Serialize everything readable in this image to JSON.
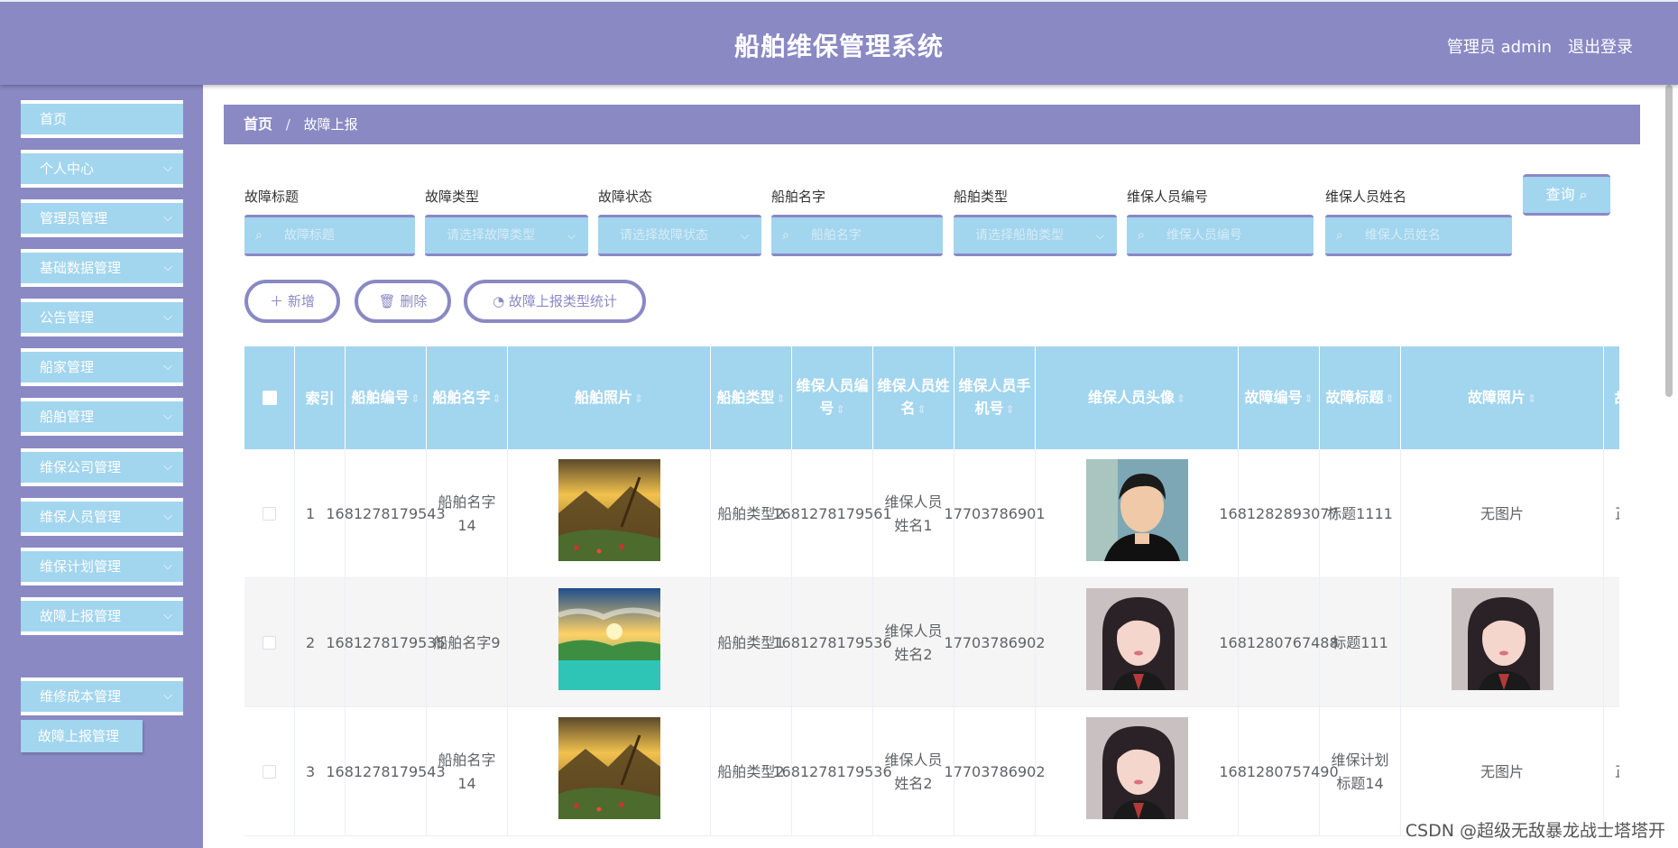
{
  "header": {
    "title": "船舶维保管理系统",
    "user": "管理员 admin",
    "logout": "退出登录"
  },
  "sidebar": {
    "items": [
      {
        "label": "首页",
        "chev": ""
      },
      {
        "label": "个人中心",
        "chev": "⌵"
      },
      {
        "label": "管理员管理",
        "chev": "⌵"
      },
      {
        "label": "基础数据管理",
        "chev": "⌵"
      },
      {
        "label": "公告管理",
        "chev": "⌵"
      },
      {
        "label": "船家管理",
        "chev": "⌵"
      },
      {
        "label": "船舶管理",
        "chev": "⌵"
      },
      {
        "label": "维保公司管理",
        "chev": "⌵"
      },
      {
        "label": "维保人员管理",
        "chev": "⌵"
      },
      {
        "label": "维保计划管理",
        "chev": "⌵"
      },
      {
        "label": "故障上报管理",
        "chev": "⌵"
      },
      {
        "label": "维修成本管理",
        "chev": "⌵"
      }
    ],
    "submenu": "故障上报管理"
  },
  "breadcrumb": {
    "home": "首页",
    "sep": "/",
    "current": "故障上报"
  },
  "search": {
    "fields": [
      {
        "label": "故障标题",
        "placeholder": "故障标题",
        "icon": "⌕",
        "dd": ""
      },
      {
        "label": "故障类型",
        "placeholder": "请选择故障类型",
        "icon": "",
        "dd": "⌵"
      },
      {
        "label": "故障状态",
        "placeholder": "请选择故障状态",
        "icon": "",
        "dd": "⌵"
      },
      {
        "label": "船舶名字",
        "placeholder": "船舶名字",
        "icon": "⌕",
        "dd": ""
      },
      {
        "label": "船舶类型",
        "placeholder": "请选择船舶类型",
        "icon": "",
        "dd": "⌵"
      },
      {
        "label": "维保人员编号",
        "placeholder": "维保人员编号",
        "icon": "⌕",
        "dd": ""
      },
      {
        "label": "维保人员姓名",
        "placeholder": "维保人员姓名",
        "icon": "⌕",
        "dd": ""
      }
    ],
    "query_label": "查询 ⌕"
  },
  "actions": {
    "add": "＋ 新增",
    "delete": "🗑 删除",
    "stats": "◔ 故障上报类型统计"
  },
  "table": {
    "sort_icon": "⇕",
    "columns": [
      {
        "label": "",
        "sort": false
      },
      {
        "label": "索引",
        "sort": false
      },
      {
        "label": "船舶编号",
        "sort": true
      },
      {
        "label": "船舶名字",
        "sort": true
      },
      {
        "label": "船舶照片",
        "sort": true
      },
      {
        "label": "船舶类型",
        "sort": true
      },
      {
        "label": "维保人员编号",
        "sort": true
      },
      {
        "label": "维保人员姓名",
        "sort": true
      },
      {
        "label": "维保人员手机号",
        "sort": true
      },
      {
        "label": "维保人员头像",
        "sort": true
      },
      {
        "label": "故障编号",
        "sort": true
      },
      {
        "label": "故障标题",
        "sort": true
      },
      {
        "label": "故障照片",
        "sort": true
      },
      {
        "label": "故",
        "sort": false
      }
    ],
    "rows": [
      {
        "index": "1",
        "ship_no": "1681278179543",
        "ship_name": "船舶名字14",
        "ship_photo": "mountain",
        "ship_type": "船舶类型2",
        "staff_no": "1681278179561",
        "staff_name": "维保人员姓名1",
        "staff_phone": "17703786901",
        "staff_avatar": "man",
        "fault_no": "1681282893077",
        "fault_title": "标题1111",
        "fault_photo": "无图片",
        "extra": "正"
      },
      {
        "index": "2",
        "ship_no": "1681278179535",
        "ship_name": "船舶名字9",
        "ship_photo": "lake",
        "ship_type": "船舶类型1",
        "staff_no": "1681278179536",
        "staff_name": "维保人员姓名2",
        "staff_phone": "17703786902",
        "staff_avatar": "woman",
        "fault_no": "1681280767488",
        "fault_title": "标题111",
        "fault_photo": "woman",
        "extra": ""
      },
      {
        "index": "3",
        "ship_no": "1681278179543",
        "ship_name": "船舶名字14",
        "ship_photo": "mountain",
        "ship_type": "船舶类型2",
        "staff_no": "1681278179536",
        "staff_name": "维保人员姓名2",
        "staff_phone": "17703786902",
        "staff_avatar": "woman",
        "fault_no": "1681280757490",
        "fault_title": "维保计划标题14",
        "fault_photo": "无图片",
        "extra": "正"
      }
    ]
  },
  "watermark": "CSDN @超级无敌暴龙战士塔塔开"
}
